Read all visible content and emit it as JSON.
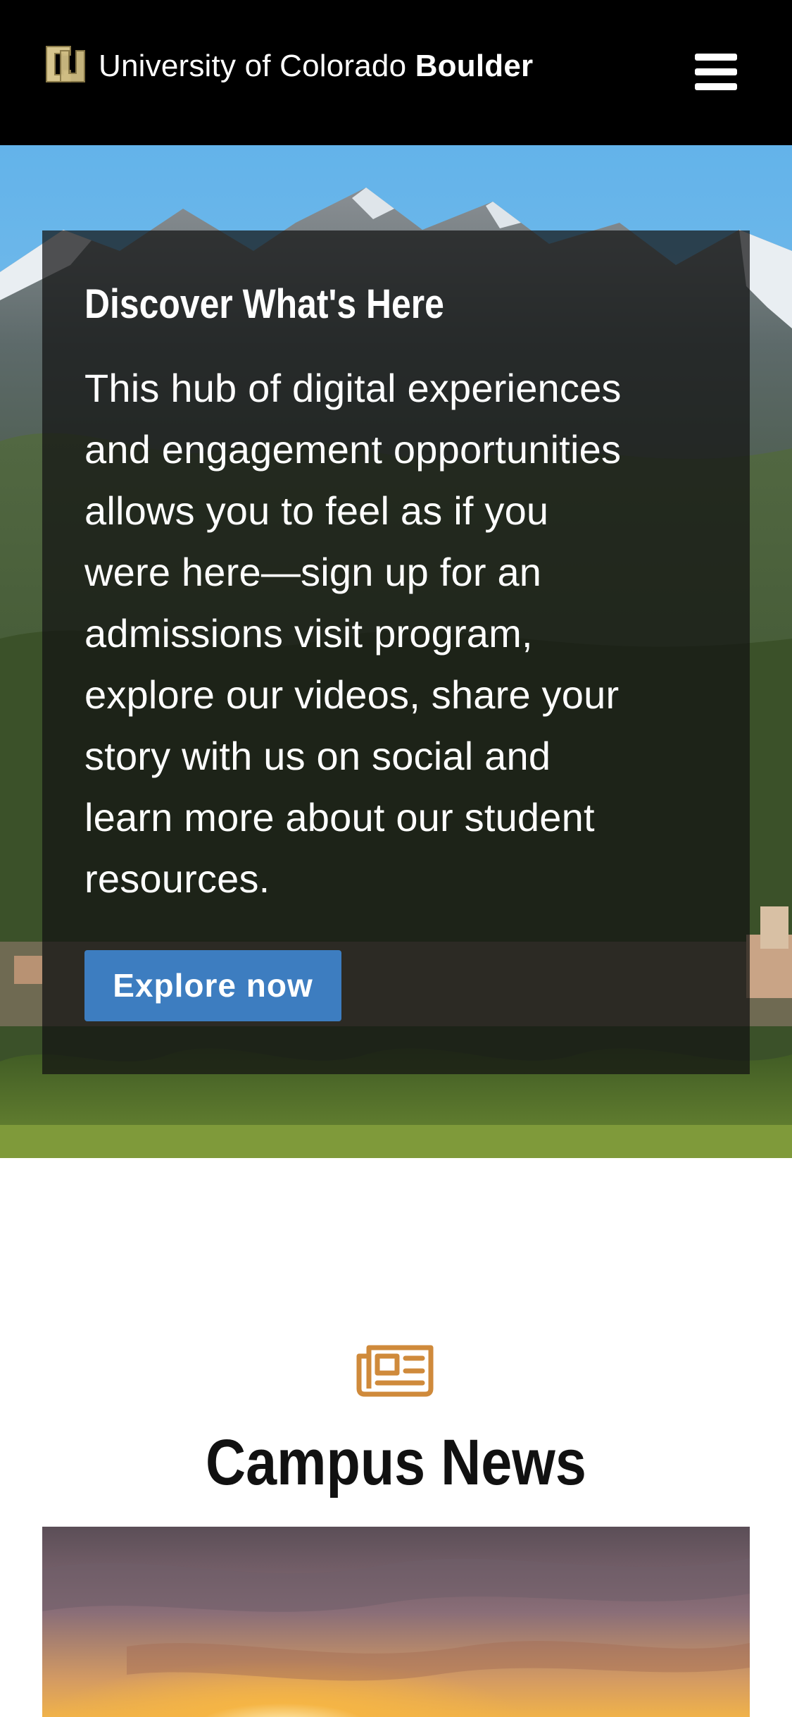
{
  "header": {
    "title_regular": "University of Colorado",
    "title_bold": "Boulder",
    "logo_icon": "cu-logo-icon",
    "menu_icon": "hamburger-menu-icon",
    "background_color": "#000000"
  },
  "hero": {
    "heading": "Discover What's Here",
    "body_lines": [
      "This hub of digital experiences",
      "and engagement opportunities",
      "allows you to feel as if you",
      "were here—sign up for an",
      "admissions visit program,",
      "explore our videos, share your",
      "story with us on social and",
      "learn more about our student",
      "resources."
    ],
    "button_label": "Explore now",
    "button_color": "#3d7dc0",
    "image": "mountain-campus-landscape"
  },
  "news": {
    "icon": "newspaper-icon",
    "icon_color": "#cf8a3b",
    "heading": "Campus News",
    "image": "sunset-sky-photo"
  }
}
